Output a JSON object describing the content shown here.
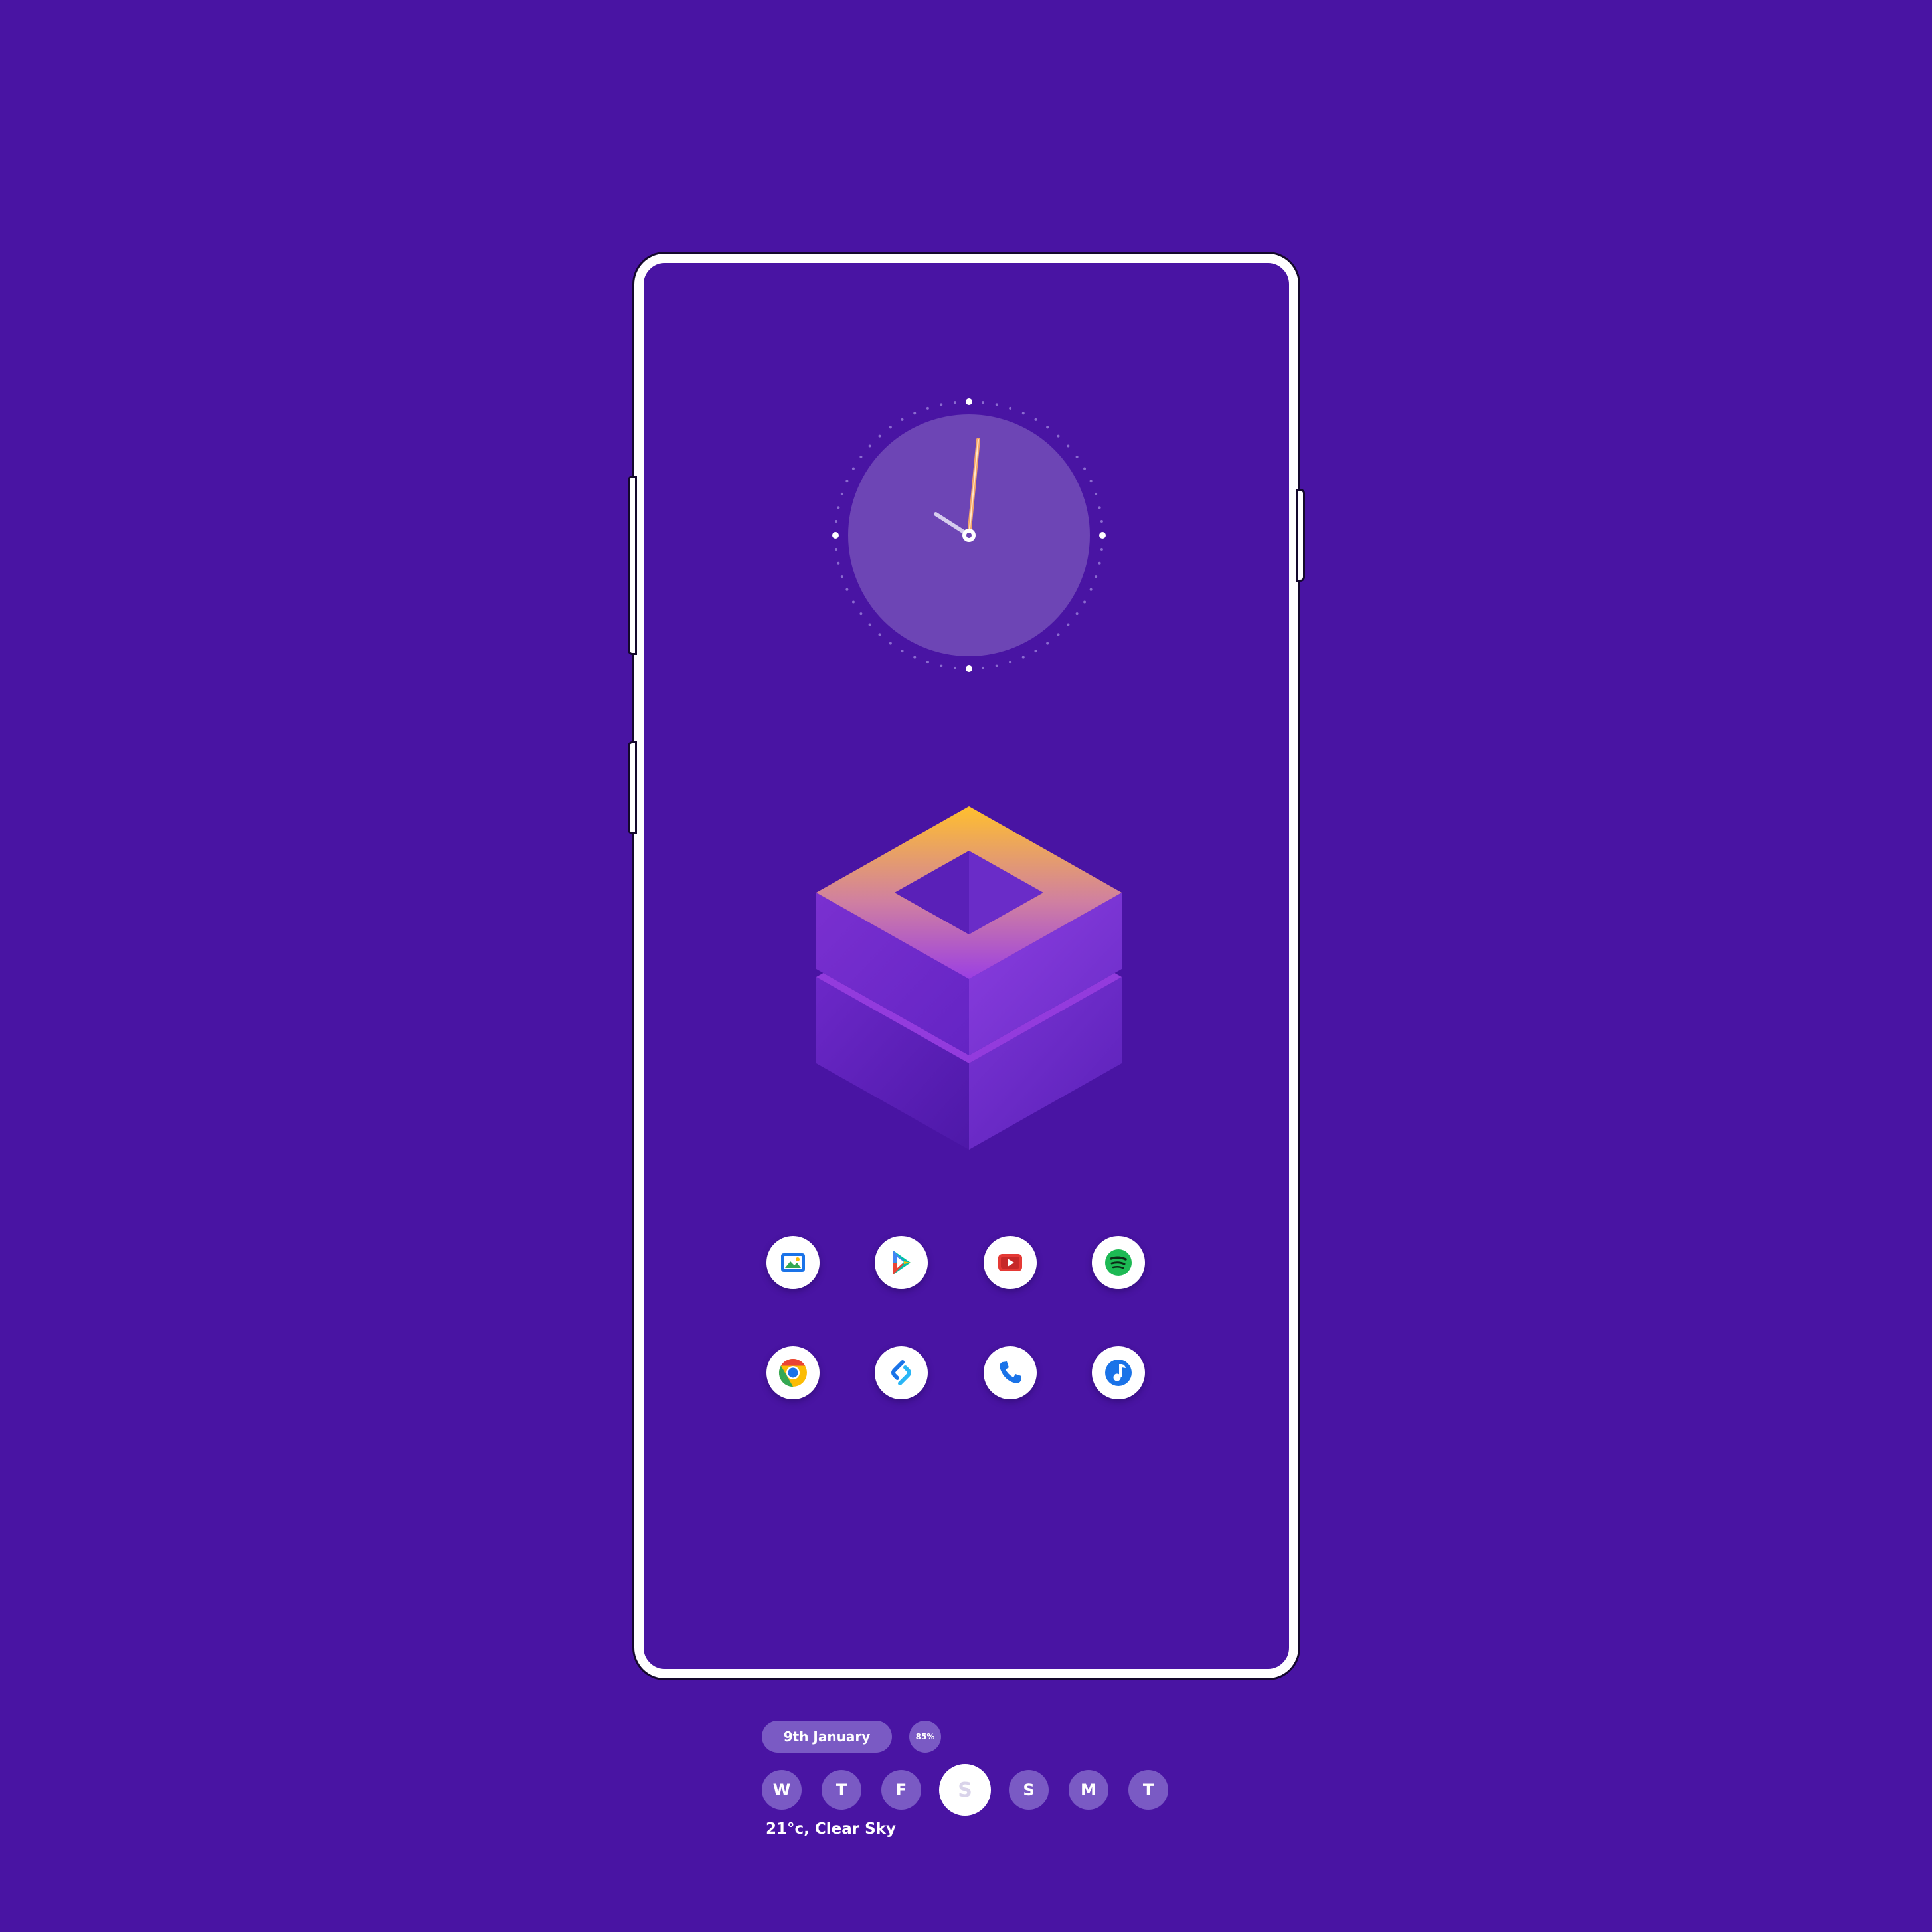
{
  "screen": {
    "background_color": "#4914a3",
    "frame_color": "#ffffff"
  },
  "clock": {
    "face_color": "#6d45b5",
    "hour_hand_color": "#d6cdee",
    "minute_hand_color": "#f2a56b"
  },
  "logo": {
    "top_gradient": [
      "#ffbf2e",
      "#9b3fe3"
    ],
    "side_color": "#7b34d4"
  },
  "apps": [
    {
      "name": "Gallery",
      "icon": "gallery-icon"
    },
    {
      "name": "Play Store",
      "icon": "play-store-icon"
    },
    {
      "name": "YouTube",
      "icon": "youtube-icon"
    },
    {
      "name": "Spotify",
      "icon": "spotify-icon"
    },
    {
      "name": "Chrome",
      "icon": "chrome-icon"
    },
    {
      "name": "Shazam",
      "icon": "shazam-icon"
    },
    {
      "name": "Phone",
      "icon": "phone-icon"
    },
    {
      "name": "Music",
      "icon": "music-icon"
    }
  ],
  "widget": {
    "date": "9th January",
    "battery": "85%",
    "days": [
      "W",
      "T",
      "F",
      "S",
      "S",
      "M",
      "T"
    ],
    "active_day_index": 3,
    "weather": "21°c, Clear Sky",
    "pill_color": "#7a5ac4"
  }
}
